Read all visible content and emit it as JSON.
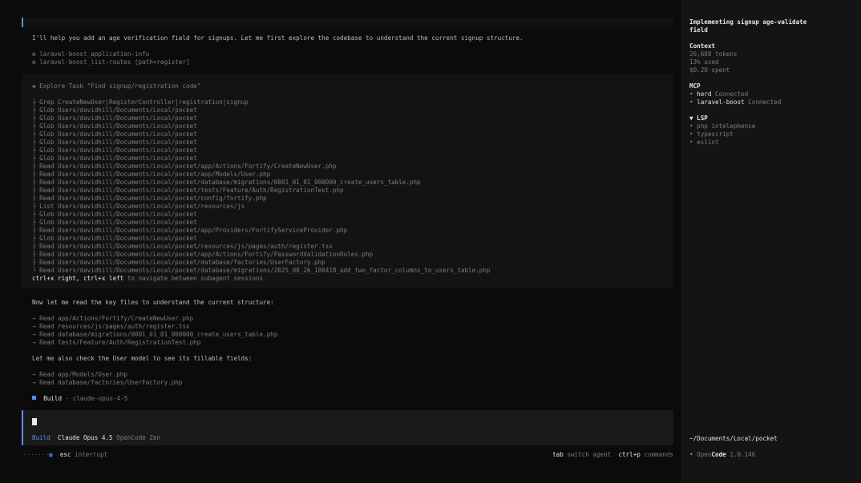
{
  "intro": "I'll help you add an age verification field for signups. Let me first explore the codebase to understand the current signup structure.",
  "tool_calls": [
    "⚙ laravel-boost_application-info",
    "⚙ laravel-boost_list-routes [path=register]"
  ],
  "task": {
    "header": "✱ Explore Task \"Find signup/registration code\"",
    "items": [
      "├ Grep CreateNewUser|RegisterController|registration|signup",
      "├ Glob Users/davidhill/Documents/Local/pocket",
      "├ Glob Users/davidhill/Documents/Local/pocket",
      "├ Glob Users/davidhill/Documents/Local/pocket",
      "├ Glob Users/davidhill/Documents/Local/pocket",
      "├ Glob Users/davidhill/Documents/Local/pocket",
      "├ Glob Users/davidhill/Documents/Local/pocket",
      "├ Glob Users/davidhill/Documents/Local/pocket",
      "├ Read Users/davidhill/Documents/Local/pocket/app/Actions/Fortify/CreateNewUser.php",
      "├ Read Users/davidhill/Documents/Local/pocket/app/Models/User.php",
      "├ Read Users/davidhill/Documents/Local/pocket/database/migrations/0001_01_01_000000_create_users_table.php",
      "├ Read Users/davidhill/Documents/Local/pocket/tests/Feature/Auth/RegistrationTest.php",
      "├ Read Users/davidhill/Documents/Local/pocket/config/fortify.php",
      "├ List Users/davidhill/Documents/Local/pocket/resources/js",
      "├ Glob Users/davidhill/Documents/Local/pocket",
      "├ Glob Users/davidhill/Documents/Local/pocket",
      "├ Read Users/davidhill/Documents/Local/pocket/app/Providers/FortifyServiceProvider.php",
      "├ Glob Users/davidhill/Documents/Local/pocket",
      "├ Read Users/davidhill/Documents/Local/pocket/resources/js/pages/auth/register.tsx",
      "├ Read Users/davidhill/Documents/Local/pocket/app/Actions/Fortify/PasswordValidationRules.php",
      "├ Read Users/davidhill/Documents/Local/pocket/database/factories/UserFactory.php",
      "└ Read Users/davidhill/Documents/Local/pocket/database/migrations/2025_08_26_100418_add_two_factor_columns_to_users_table.php"
    ],
    "nav_keys": "ctrl+x right, ctrl+x left",
    "nav_hint": "to navigate between subagent sessions"
  },
  "read_intro": "Now let me read the key files to understand the current structure:",
  "reads": [
    "→ Read app/Actions/Fortify/CreateNewUser.php",
    "→ Read resources/js/pages/auth/register.tsx",
    "→ Read database/migrations/0001_01_01_000000_create_users_table.php",
    "→ Read tests/Feature/Auth/RegistrationTest.php"
  ],
  "model_intro": "Let me also check the User model to see its fillable fields:",
  "reads2": [
    "→ Read app/Models/User.php",
    "→ Read database/factories/UserFactory.php"
  ],
  "build_status": {
    "agent": "Build",
    "model": "· claude-opus-4-5"
  },
  "input": {
    "agent": "Build",
    "model": "Claude Opus 4.5",
    "provider": "OpenCode Zen"
  },
  "footer": {
    "progress": "·······■",
    "interrupt_key": "esc",
    "interrupt_label": "interrupt",
    "switch_key": "tab",
    "switch_label": "switch agent",
    "commands_key": "ctrl+p",
    "commands_label": "commands"
  },
  "sidebar": {
    "title_line1": "Implementing signup age-validate",
    "title_line2": "field",
    "context_head": "Context",
    "tokens": "26,608 tokens",
    "used": "13% used",
    "spent": "$0.20 spent",
    "mcp_head": "MCP",
    "mcp": [
      {
        "bullet": "•",
        "name": "herd",
        "status": "Connected"
      },
      {
        "bullet": "•",
        "name": "laravel-boost",
        "status": "Connected"
      }
    ],
    "lsp_head": "▼ LSP",
    "lsp": [
      "• php intelephense",
      "• typescript",
      "• eslint"
    ],
    "path": "~/Documents/Local/pocket",
    "version_bullet": "•",
    "version_open": "Open",
    "version_code": "Code",
    "version_num": "1.0.146"
  },
  "colors": {
    "accent": "#5b8fe8",
    "connected": "#4fb36a",
    "background": "#0b0b0b",
    "sidebar": "#141414",
    "panel": "#131313"
  }
}
